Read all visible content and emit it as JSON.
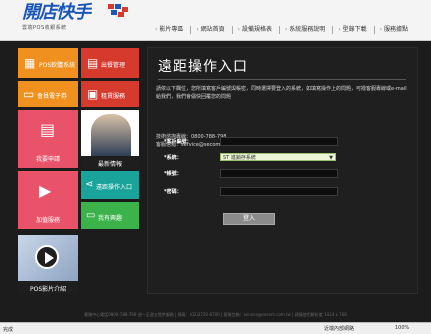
{
  "header": {
    "logo_title": "開店快手",
    "logo_subtitle": "雲端POS收銀系統",
    "nav": [
      "影片專區",
      "網站首頁",
      "設備規格表",
      "系統服務說明",
      "型錄下載",
      "服務據點"
    ]
  },
  "tiles": {
    "pos_system": "POS軟體系統",
    "ordering": "出餐管理",
    "voucher": "會員電子券",
    "query": "租賃服務",
    "register": "我要申請",
    "news": "最新情報",
    "remote": "遠距操作入口",
    "about": "我有興趣",
    "value_added": "加值服務",
    "video": "POS影片介紹"
  },
  "panel": {
    "title": "遠距操作入口",
    "intro": "請依以下欄位，您所填寫客戶編號與帳密，同時選擇要登入的系統，如填寫操作上的問題，可撥客服專線或e-mail給我們，我們會儘快回覆您的問題",
    "phone": "技術諮詢專線：0800-788-798",
    "email": "客服信箱：service@secom.com.tw",
    "fields": {
      "customer_id_label": "*客戶編號：",
      "system_label": "*系統：",
      "system_value": "ST 進銷存系統",
      "account_label": "*帳號：",
      "password_label": "*密碼："
    },
    "login_button": "登入"
  },
  "footer": {
    "copyright": "客服中心電話0800-788-798 週一至週五提供服務 | 傳真：(02)2720-6700 | 客服信箱：service@secom.com.tw | 建議使用解析度 1024 x 768"
  },
  "statusbar": {
    "done": "完成",
    "zone": "近端內部網路",
    "zoom": "100%"
  },
  "colors": {
    "orange": "#f0901e",
    "red": "#d63a2d",
    "pink": "#e8536a",
    "teal": "#1aa39a",
    "green": "#3bb34a",
    "accent_blue": "#1a56b8"
  }
}
